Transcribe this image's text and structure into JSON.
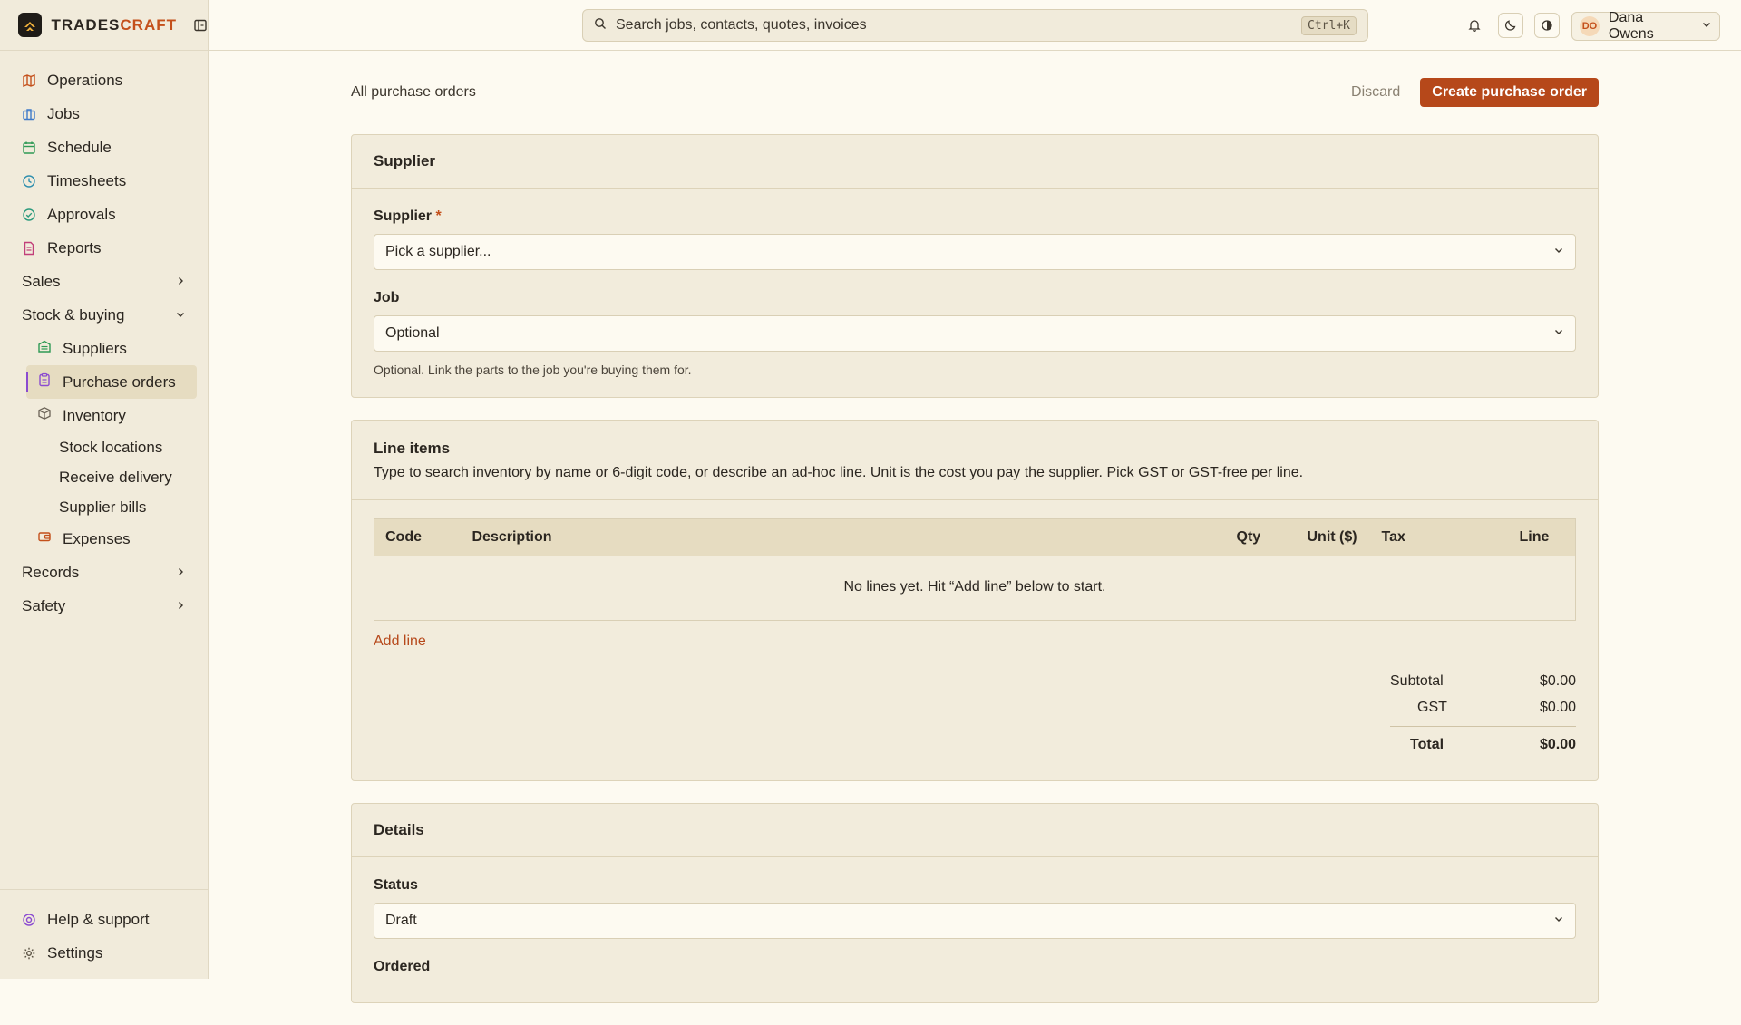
{
  "brand": {
    "name_main": "TRADES",
    "name_accent": "CRAFT"
  },
  "search": {
    "placeholder": "Search jobs, contacts, quotes, invoices",
    "shortcut": "Ctrl+K"
  },
  "user": {
    "initials": "DO",
    "name": "Dana Owens"
  },
  "sidebar": {
    "items": [
      {
        "label": "Operations",
        "icon": "map-icon"
      },
      {
        "label": "Jobs",
        "icon": "briefcase-icon"
      },
      {
        "label": "Schedule",
        "icon": "calendar-icon"
      },
      {
        "label": "Timesheets",
        "icon": "clock-icon"
      },
      {
        "label": "Approvals",
        "icon": "check-circle-icon"
      },
      {
        "label": "Reports",
        "icon": "document-icon"
      }
    ],
    "groups": {
      "sales": "Sales",
      "stock": "Stock & buying",
      "records": "Records",
      "safety": "Safety"
    },
    "stock_items": {
      "suppliers": "Suppliers",
      "purchase_orders": "Purchase orders",
      "inventory": "Inventory",
      "stock_locations": "Stock locations",
      "receive_delivery": "Receive delivery",
      "supplier_bills": "Supplier bills",
      "expenses": "Expenses"
    },
    "bottom": {
      "help": "Help & support",
      "settings": "Settings"
    }
  },
  "page": {
    "breadcrumb": "All purchase orders",
    "discard": "Discard",
    "create": "Create purchase order"
  },
  "supplier_card": {
    "title": "Supplier",
    "supplier_label": "Supplier",
    "required_mark": "*",
    "supplier_placeholder": "Pick a supplier...",
    "job_label": "Job",
    "job_value": "Optional",
    "job_hint": "Optional. Link the parts to the job you're buying them for."
  },
  "lines_card": {
    "title": "Line items",
    "description": "Type to search inventory by name or 6-digit code, or describe an ad-hoc line. Unit is the cost you pay the supplier. Pick GST or GST-free per line.",
    "columns": [
      "Code",
      "Description",
      "Qty",
      "Unit ($)",
      "Tax",
      "Line"
    ],
    "empty": "No lines yet. Hit “Add line” below to start.",
    "add_line": "Add line",
    "subtotal_label": "Subtotal",
    "subtotal": "$0.00",
    "gst_label": "GST",
    "gst": "$0.00",
    "total_label": "Total",
    "total": "$0.00"
  },
  "details_card": {
    "title": "Details",
    "status_label": "Status",
    "status_value": "Draft",
    "ordered_label": "Ordered"
  },
  "colors": {
    "accent": "#b6481a",
    "sidebar_bg": "#f1ebdb",
    "page_bg": "#fdfaf1",
    "active_marker": "#8b4bd0"
  }
}
